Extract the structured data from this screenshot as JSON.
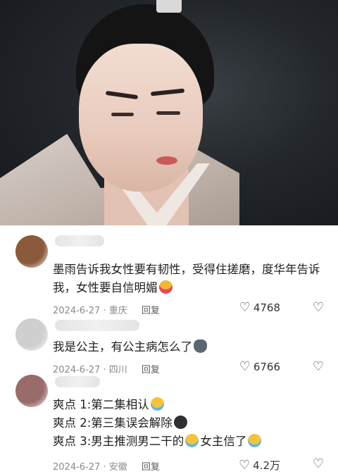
{
  "comments": [
    {
      "text": "墨雨告诉我女性要有韧性，受得住搓磨，度华年告诉我，女性要自信明媚",
      "emoji": "tongue-out-face",
      "date": "2024-6-27",
      "location": "重庆",
      "reply_label": "回复",
      "likes": "4768",
      "avatar_color": "#8b5a3c"
    },
    {
      "text": "我是公主，有公主病怎么了",
      "emoji": "cat-face",
      "date": "2024-6-27",
      "location": "四川",
      "reply_label": "回复",
      "likes": "6766",
      "avatar_color": "#cfcfcf"
    },
    {
      "lines": [
        {
          "text": "爽点 1:第二集相认",
          "emoji_after": "crying-face"
        },
        {
          "text": "爽点 2:第三集误会解除",
          "emoji_after": "dark-face"
        },
        {
          "text_a": "爽点 3:男主推测男二干的",
          "emoji_mid": "crying-face",
          "text_b": "女主信了",
          "emoji_after": "crying-face"
        }
      ],
      "date": "2024-6-27",
      "location": "安徽",
      "reply_label": "回复",
      "likes": "4.2万",
      "avatar_color": "#9a6b6b"
    }
  ],
  "icons": {
    "like": "heart-outline-icon",
    "dislike": "broken-heart-icon"
  }
}
